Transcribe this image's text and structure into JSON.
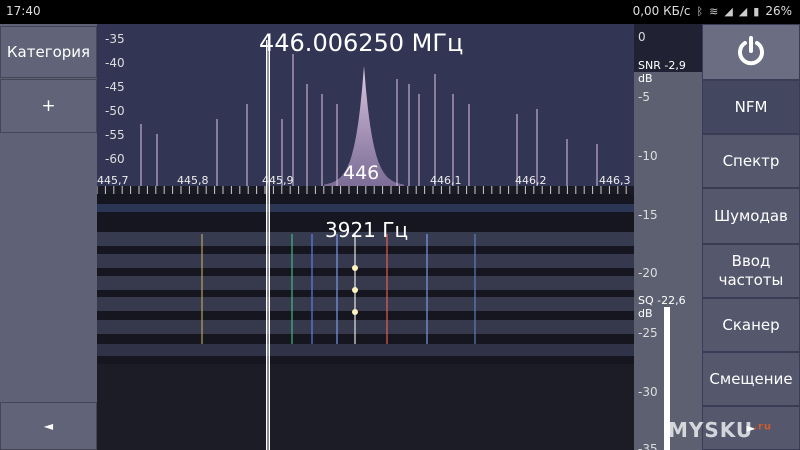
{
  "status_bar": {
    "time": "17:40",
    "speed": "0,00 КБ/с",
    "battery": "26%",
    "icons": [
      "bluetooth-icon",
      "wifi-icon",
      "signal-icon",
      "signal-icon",
      "battery-icon"
    ]
  },
  "left_panel": {
    "category_label": "Категория",
    "add_label": "+",
    "back_label": "◄"
  },
  "spectrum": {
    "frequency": "446.006250 МГц",
    "center_label": "446",
    "offset": "3921 Гц",
    "y_labels": [
      "-35",
      "-40",
      "-45",
      "-50",
      "-55",
      "-60"
    ],
    "x_labels": [
      "445,7",
      "445,8",
      "445,9",
      "446",
      "446,1",
      "446,2",
      "446,3"
    ]
  },
  "snr": {
    "scale": [
      "0",
      "-5",
      "-10",
      "-15",
      "-20",
      "-25",
      "-30",
      "-35"
    ],
    "snr_label": "SNR -2,9 dB",
    "sq_label": "SQ -22,6 dB"
  },
  "right_panel": {
    "power_icon": "power-icon",
    "mode": "NFM",
    "spectrum": "Спектр",
    "noise_reduction": "Шумодав",
    "freq_input": "Ввод частоты",
    "scanner": "Сканер",
    "offset": "Смещение",
    "more": "►"
  },
  "watermark": {
    "text": "MYSKU",
    "suffix": ".ru"
  }
}
